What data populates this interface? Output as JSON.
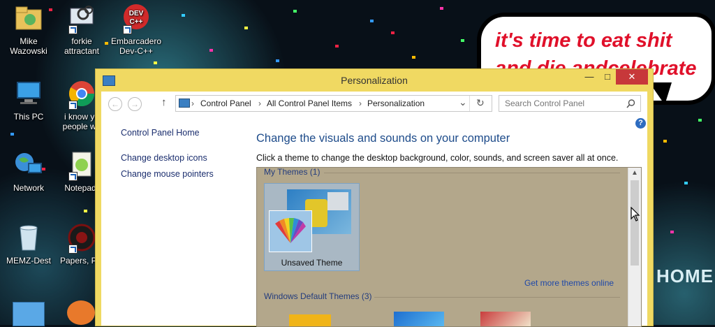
{
  "desktop": {
    "icons": [
      {
        "label": "Mike Wazowski",
        "icon": "folder-icon"
      },
      {
        "label": "forkie attractant",
        "icon": "settings-shortcut-icon"
      },
      {
        "label": "Embarcadero Dev-C++",
        "icon": "devcpp-icon"
      },
      {
        "label": "This PC",
        "icon": "computer-icon"
      },
      {
        "label": "i know yo people we",
        "icon": "chrome-icon"
      },
      {
        "label": "Network",
        "icon": "network-icon"
      },
      {
        "label": "Notepad-",
        "icon": "notepad-icon"
      },
      {
        "label": "MEMZ-Dest",
        "icon": "recycle-bin-icon"
      },
      {
        "label": "Papers, Ple",
        "icon": "papers-please-icon"
      }
    ],
    "speech_bubble_text": "it's time to eat shit and die andcelebrate",
    "wallpaper_text": "HOME"
  },
  "window": {
    "title": "Personalization",
    "minimize": "—",
    "maximize": "□",
    "close": "✕",
    "nav": {
      "back": "←",
      "forward": "→",
      "up": "↑"
    },
    "breadcrumb": [
      "Control Panel",
      "All Control Panel Items",
      "Personalization"
    ],
    "separator": "›",
    "dropdown": "⌄",
    "refresh": "↻",
    "search_placeholder": "Search Control Panel",
    "help": "?"
  },
  "sidebar": {
    "home": "Control Panel Home",
    "links": [
      "Change desktop icons",
      "Change mouse pointers"
    ]
  },
  "main": {
    "title": "Change the visuals and sounds on your computer",
    "description": "Click a theme to change the desktop background, color, sounds, and screen saver all at once.",
    "my_themes_header": "My Themes (1)",
    "current_theme": "Unsaved Theme",
    "get_more": "Get more themes online",
    "windows_themes_header": "Windows Default Themes (3)"
  },
  "colors": {
    "window_frame": "#f0d962",
    "close_button": "#c7383a",
    "link": "#1f48a8",
    "title_blue": "#1d4b8a",
    "theme_pane": "#b3a78b"
  }
}
